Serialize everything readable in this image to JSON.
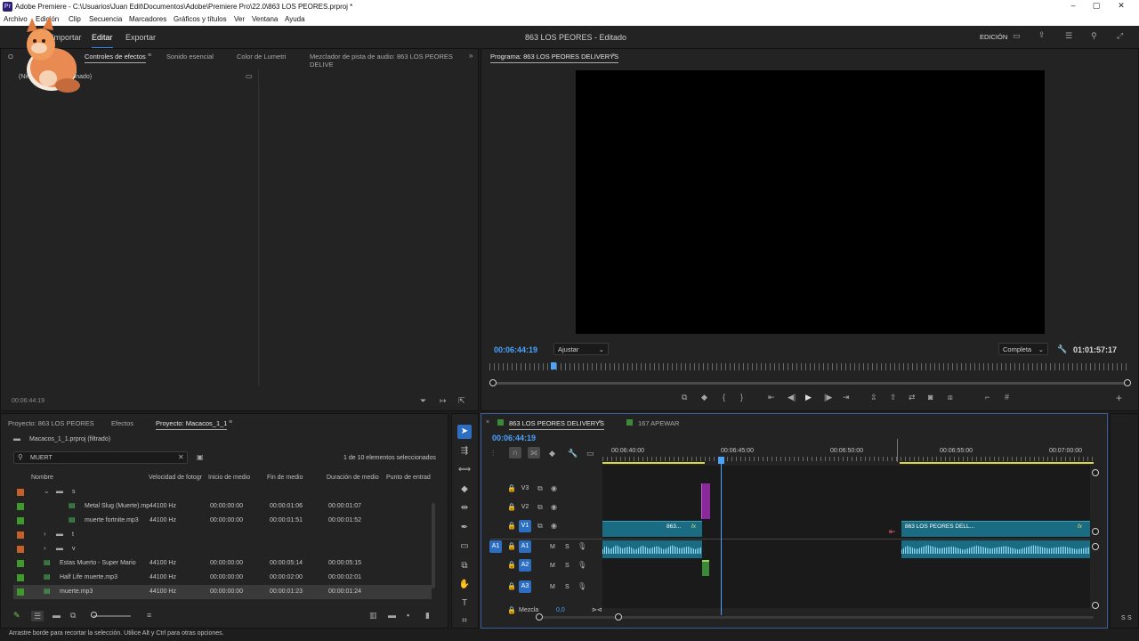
{
  "window": {
    "app_badge": "Pr",
    "title": "Adobe Premiere - C:\\Usuarios\\Juan Edit\\Documentos\\Adobe\\Premiere Pro\\22.0\\863 LOS PEORES.prproj *",
    "controls": [
      "–",
      "▢",
      "✕"
    ]
  },
  "menu": [
    "Archivo",
    "Edición",
    "Clip",
    "Secuencia",
    "Marcadores",
    "Gráficos y títulos",
    "Ver",
    "Ventana",
    "Ayuda"
  ],
  "header": {
    "workspaces": [
      "Importar",
      "Editar",
      "Exportar"
    ],
    "active_workspace": "Editar",
    "project_title": "863 LOS PEORES - Editado",
    "workspace_label": "EDICIÓN"
  },
  "source_panel": {
    "tabs": [
      "Controles de efectos",
      "Sonido esencial",
      "Color de Lumetri",
      "Mezclador de pista de audio: 863 LOS PEORES DELIVE"
    ],
    "active_tab": "Controles de efectos",
    "partial_tab": "O",
    "no_clip_text": "(Ningún clip seleccionado)",
    "timecode": "00:06:44:19"
  },
  "program_monitor": {
    "title": "Programa: 863 LOS PEORES DELIVERYS",
    "timecode": "00:06:44:19",
    "fit": "Ajustar",
    "quality": "Completa",
    "duration": "01:01:57:17",
    "playhead_fraction": 0.1
  },
  "project_panel": {
    "tabs": [
      "Proyecto: 863 LOS PEORES",
      "Efectos",
      "Proyecto: Macacos_1_1"
    ],
    "active_tab": "Proyecto: Macacos_1_1",
    "filename": "Macacos_1_1.prproj (filtrado)",
    "search": "MUERT",
    "selection_count": "1 de 10 elementos seleccionados",
    "columns": [
      "Nombre",
      "Velocidad de fotogr",
      "Inicio de medio",
      "Fin de medio",
      "Duración de medio",
      "Punto de entrad"
    ],
    "rows": [
      {
        "color": "#c4602a",
        "type": "folder",
        "indent": 1,
        "expanded": true,
        "name": "s",
        "rate": "",
        "start": "",
        "end": "",
        "dur": ""
      },
      {
        "color": "#3c9b2c",
        "type": "audio",
        "indent": 2,
        "name": "Metal Slug (Muerte).mp",
        "rate": "44100 Hz",
        "start": "00:00:00:00",
        "end": "00:00:01:06",
        "dur": "00:00:01:07"
      },
      {
        "color": "#3c9b2c",
        "type": "audio",
        "indent": 2,
        "name": "muerte fortnite.mp3",
        "rate": "44100 Hz",
        "start": "00:00:00:00",
        "end": "00:00:01:51",
        "dur": "00:00:01:52"
      },
      {
        "color": "#c4602a",
        "type": "folder",
        "indent": 1,
        "expanded": false,
        "name": "t",
        "rate": "",
        "start": "",
        "end": "",
        "dur": ""
      },
      {
        "color": "#c4602a",
        "type": "folder",
        "indent": 1,
        "expanded": false,
        "name": "v",
        "rate": "",
        "start": "",
        "end": "",
        "dur": ""
      },
      {
        "color": "#3c9b2c",
        "type": "audio",
        "indent": 0,
        "name": "Estas Muerto - Super Mario",
        "rate": "44100 Hz",
        "start": "00:00:00:00",
        "end": "00:00:05:14",
        "dur": "00:00:05:15"
      },
      {
        "color": "#3c9b2c",
        "type": "audio",
        "indent": 0,
        "name": "Half Life muerte.mp3",
        "rate": "44100 Hz",
        "start": "00:00:00:00",
        "end": "00:00:02:00",
        "dur": "00:00:02:01"
      },
      {
        "color": "#3c9b2c",
        "type": "audio",
        "indent": 0,
        "selected": true,
        "name": "muerte.mp3",
        "rate": "44100 Hz",
        "start": "00:00:00:00",
        "end": "00:00:01:23",
        "dur": "00:00:01:24"
      }
    ]
  },
  "timeline": {
    "tabs": [
      "863 LOS PEORES DELIVERYS",
      "167 APEWAR"
    ],
    "active_tab": "863 LOS PEORES DELIVERYS",
    "timecode": "00:06:44:19",
    "ruler_labels": [
      "00:06:40:00",
      "00:06:45:00",
      "00:06:50:00",
      "00:06:55:00",
      "00:07:00:00"
    ],
    "tracks": [
      {
        "id": "V3",
        "kind": "video"
      },
      {
        "id": "V2",
        "kind": "video"
      },
      {
        "id": "V1",
        "kind": "video",
        "targeted": true
      },
      {
        "id": "A1",
        "kind": "audio",
        "targeted": true,
        "source": "A1"
      },
      {
        "id": "A2",
        "kind": "audio"
      },
      {
        "id": "A3",
        "kind": "audio"
      }
    ],
    "track_buttons": {
      "mute": "M",
      "solo": "S"
    },
    "mix_label": "Mezcla",
    "mix_value": "0,0",
    "clip_labels": [
      "863...",
      "863 LOS PEORES DELL..."
    ],
    "fx": "fx"
  },
  "status_bar": "Arrastre borde para recortar la selección. Utilice Alt y Ctrl para otras opciones.",
  "meter_labels": [
    "S",
    "S"
  ]
}
